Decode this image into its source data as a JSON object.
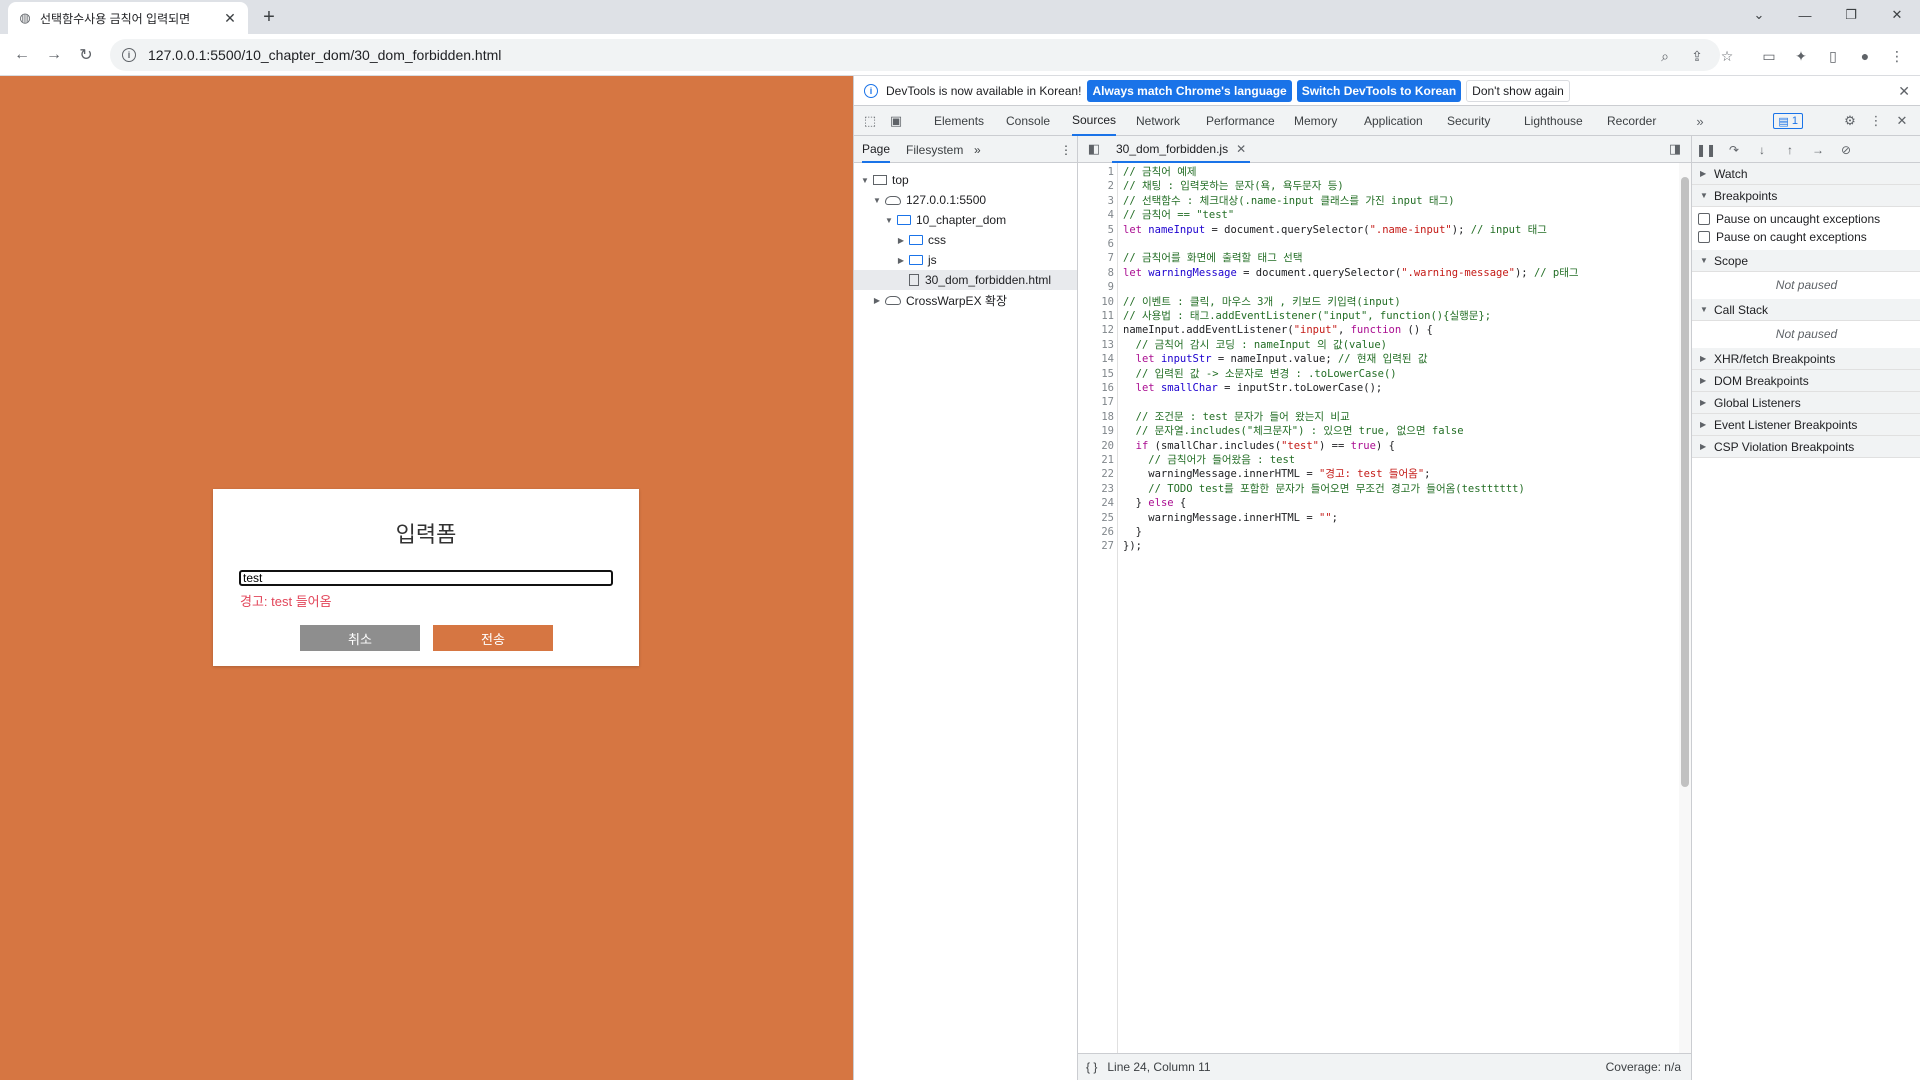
{
  "browser": {
    "tab_title": "선택함수사용 금칙어 입력되면 ",
    "tab_close": "✕",
    "new_tab": "+",
    "url": "127.0.0.1:5500/10_chapter_dom/30_dom_forbidden.html"
  },
  "page": {
    "form_title": "입력폼",
    "input_value": "test",
    "warning": "경고: test 들어옴",
    "cancel_label": "취소",
    "submit_label": "전송",
    "bg_color": "#d67642"
  },
  "devtools": {
    "info_message": "DevTools is now available in Korean!",
    "btn_match": "Always match Chrome's language",
    "btn_switch": "Switch DevTools to Korean",
    "btn_dont_show": "Don't show again",
    "tabs": [
      "Elements",
      "Console",
      "Sources",
      "Network",
      "Performance",
      "Memory",
      "Application",
      "Security",
      "Lighthouse",
      "Recorder"
    ],
    "active_tab": "Sources",
    "issues_badge": "1",
    "navigator": {
      "tabs": [
        "Page",
        "Filesystem"
      ],
      "tree": [
        {
          "label": "top",
          "kind": "frame"
        },
        {
          "label": "127.0.0.1:5500",
          "kind": "cloud"
        },
        {
          "label": "10_chapter_dom",
          "kind": "folder"
        },
        {
          "label": "css",
          "kind": "folder"
        },
        {
          "label": "js",
          "kind": "folder"
        },
        {
          "label": "30_dom_forbidden.html",
          "kind": "file"
        },
        {
          "label": "CrossWarpEX 확장",
          "kind": "cloud"
        }
      ]
    },
    "editor": {
      "file_tab": "30_dom_forbidden.js",
      "code_lines": [
        [
          [
            "cm",
            "// 금칙어 예제"
          ]
        ],
        [
          [
            "cm",
            "// 채팅 : 입력못하는 문자(욕, 욕두문자 등)"
          ]
        ],
        [
          [
            "cm",
            "// 선택함수 : 체크대상(.name-input 클래스를 가진 input 태그)"
          ]
        ],
        [
          [
            "cm",
            "// 금칙어 == \"test\""
          ]
        ],
        [
          [
            "kw",
            "let "
          ],
          [
            "vr",
            "nameInput"
          ],
          [
            "tx",
            " = document.querySelector("
          ],
          [
            "st",
            "\".name-input\""
          ],
          [
            "tx",
            "); "
          ],
          [
            "cm",
            "// input 태그"
          ]
        ],
        [],
        [
          [
            "cm",
            "// 금칙어를 화면에 출력할 태그 선택"
          ]
        ],
        [
          [
            "kw",
            "let "
          ],
          [
            "vr",
            "warningMessage"
          ],
          [
            "tx",
            " = document.querySelector("
          ],
          [
            "st",
            "\".warning-message\""
          ],
          [
            "tx",
            "); "
          ],
          [
            "cm",
            "// p태그"
          ]
        ],
        [],
        [
          [
            "cm",
            "// 이벤트 : 클릭, 마우스 3개 , 키보드 키입력(input)"
          ]
        ],
        [
          [
            "cm",
            "// 사용법 : 태그.addEventListener(\"input\", function(){실행문};"
          ]
        ],
        [
          [
            "tx",
            "nameInput.addEventListener("
          ],
          [
            "st",
            "\"input\""
          ],
          [
            "tx",
            ", "
          ],
          [
            "kw",
            "function"
          ],
          [
            "tx",
            " () {"
          ]
        ],
        [
          [
            "tx",
            "  "
          ],
          [
            "cm",
            "// 금칙어 감시 코딩 : nameInput 의 값(value)"
          ]
        ],
        [
          [
            "tx",
            "  "
          ],
          [
            "kw",
            "let "
          ],
          [
            "vr",
            "inputStr"
          ],
          [
            "tx",
            " = nameInput.value; "
          ],
          [
            "cm",
            "// 현재 입력된 값"
          ]
        ],
        [
          [
            "tx",
            "  "
          ],
          [
            "cm",
            "// 입력된 값 -> 소문자로 변경 : .toLowerCase()"
          ]
        ],
        [
          [
            "tx",
            "  "
          ],
          [
            "kw",
            "let "
          ],
          [
            "vr",
            "smallChar"
          ],
          [
            "tx",
            " = inputStr.toLowerCase();"
          ]
        ],
        [],
        [
          [
            "tx",
            "  "
          ],
          [
            "cm",
            "// 조건문 : test 문자가 들어 왔는지 비교"
          ]
        ],
        [
          [
            "tx",
            "  "
          ],
          [
            "cm",
            "// 문자열.includes(\"체크문자\") : 있으면 true, 없으면 false"
          ]
        ],
        [
          [
            "tx",
            "  "
          ],
          [
            "kw",
            "if"
          ],
          [
            "tx",
            " (smallChar.includes("
          ],
          [
            "st",
            "\"test\""
          ],
          [
            "tx",
            ") == "
          ],
          [
            "kw",
            "true"
          ],
          [
            "tx",
            ") {"
          ]
        ],
        [
          [
            "tx",
            "    "
          ],
          [
            "cm",
            "// 금칙어가 들어왔음 : test"
          ]
        ],
        [
          [
            "tx",
            "    warningMessage.innerHTML = "
          ],
          [
            "st",
            "\"경고: test 들어옴\""
          ],
          [
            "tx",
            ";"
          ]
        ],
        [
          [
            "tx",
            "    "
          ],
          [
            "cm",
            "// TODO test를 포함한 문자가 들어오면 무조건 경고가 들어옴(testttttt)"
          ]
        ],
        [
          [
            "tx",
            "  } "
          ],
          [
            "kw",
            "else"
          ],
          [
            "tx",
            " {"
          ]
        ],
        [
          [
            "tx",
            "    warningMessage.innerHTML = "
          ],
          [
            "st",
            "\"\""
          ],
          [
            "tx",
            ";"
          ]
        ],
        [
          [
            "tx",
            "  }"
          ]
        ],
        [
          [
            "tx",
            "});"
          ]
        ]
      ],
      "status_position": "Line 24, Column 11",
      "status_coverage": "Coverage: n/a"
    },
    "debugger": {
      "watch": "Watch",
      "breakpoints": "Breakpoints",
      "pause_uncaught": "Pause on uncaught exceptions",
      "pause_caught": "Pause on caught exceptions",
      "scope": "Scope",
      "not_paused_1": "Not paused",
      "call_stack": "Call Stack",
      "not_paused_2": "Not paused",
      "xhr": "XHR/fetch Breakpoints",
      "dom": "DOM Breakpoints",
      "global": "Global Listeners",
      "event": "Event Listener Breakpoints",
      "csp": "CSP Violation Breakpoints"
    }
  }
}
